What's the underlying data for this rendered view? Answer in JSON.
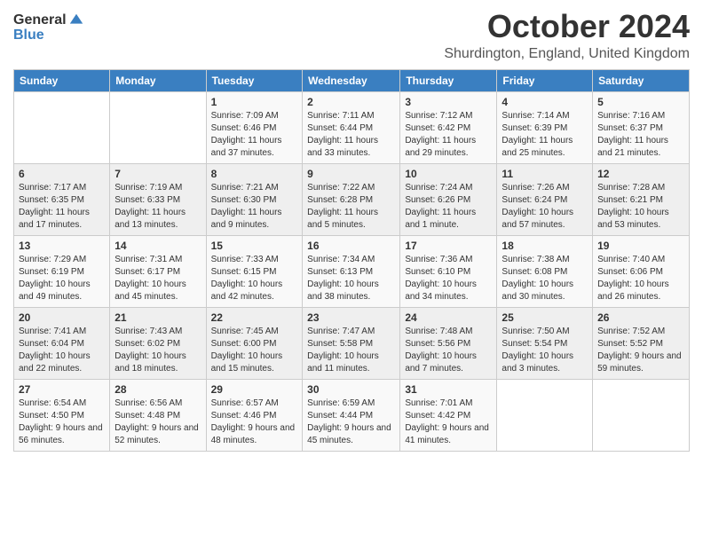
{
  "logo": {
    "general": "General",
    "blue": "Blue"
  },
  "header": {
    "month": "October 2024",
    "location": "Shurdington, England, United Kingdom"
  },
  "days_of_week": [
    "Sunday",
    "Monday",
    "Tuesday",
    "Wednesday",
    "Thursday",
    "Friday",
    "Saturday"
  ],
  "weeks": [
    [
      {
        "day": "",
        "info": ""
      },
      {
        "day": "",
        "info": ""
      },
      {
        "day": "1",
        "info": "Sunrise: 7:09 AM\nSunset: 6:46 PM\nDaylight: 11 hours and 37 minutes."
      },
      {
        "day": "2",
        "info": "Sunrise: 7:11 AM\nSunset: 6:44 PM\nDaylight: 11 hours and 33 minutes."
      },
      {
        "day": "3",
        "info": "Sunrise: 7:12 AM\nSunset: 6:42 PM\nDaylight: 11 hours and 29 minutes."
      },
      {
        "day": "4",
        "info": "Sunrise: 7:14 AM\nSunset: 6:39 PM\nDaylight: 11 hours and 25 minutes."
      },
      {
        "day": "5",
        "info": "Sunrise: 7:16 AM\nSunset: 6:37 PM\nDaylight: 11 hours and 21 minutes."
      }
    ],
    [
      {
        "day": "6",
        "info": "Sunrise: 7:17 AM\nSunset: 6:35 PM\nDaylight: 11 hours and 17 minutes."
      },
      {
        "day": "7",
        "info": "Sunrise: 7:19 AM\nSunset: 6:33 PM\nDaylight: 11 hours and 13 minutes."
      },
      {
        "day": "8",
        "info": "Sunrise: 7:21 AM\nSunset: 6:30 PM\nDaylight: 11 hours and 9 minutes."
      },
      {
        "day": "9",
        "info": "Sunrise: 7:22 AM\nSunset: 6:28 PM\nDaylight: 11 hours and 5 minutes."
      },
      {
        "day": "10",
        "info": "Sunrise: 7:24 AM\nSunset: 6:26 PM\nDaylight: 11 hours and 1 minute."
      },
      {
        "day": "11",
        "info": "Sunrise: 7:26 AM\nSunset: 6:24 PM\nDaylight: 10 hours and 57 minutes."
      },
      {
        "day": "12",
        "info": "Sunrise: 7:28 AM\nSunset: 6:21 PM\nDaylight: 10 hours and 53 minutes."
      }
    ],
    [
      {
        "day": "13",
        "info": "Sunrise: 7:29 AM\nSunset: 6:19 PM\nDaylight: 10 hours and 49 minutes."
      },
      {
        "day": "14",
        "info": "Sunrise: 7:31 AM\nSunset: 6:17 PM\nDaylight: 10 hours and 45 minutes."
      },
      {
        "day": "15",
        "info": "Sunrise: 7:33 AM\nSunset: 6:15 PM\nDaylight: 10 hours and 42 minutes."
      },
      {
        "day": "16",
        "info": "Sunrise: 7:34 AM\nSunset: 6:13 PM\nDaylight: 10 hours and 38 minutes."
      },
      {
        "day": "17",
        "info": "Sunrise: 7:36 AM\nSunset: 6:10 PM\nDaylight: 10 hours and 34 minutes."
      },
      {
        "day": "18",
        "info": "Sunrise: 7:38 AM\nSunset: 6:08 PM\nDaylight: 10 hours and 30 minutes."
      },
      {
        "day": "19",
        "info": "Sunrise: 7:40 AM\nSunset: 6:06 PM\nDaylight: 10 hours and 26 minutes."
      }
    ],
    [
      {
        "day": "20",
        "info": "Sunrise: 7:41 AM\nSunset: 6:04 PM\nDaylight: 10 hours and 22 minutes."
      },
      {
        "day": "21",
        "info": "Sunrise: 7:43 AM\nSunset: 6:02 PM\nDaylight: 10 hours and 18 minutes."
      },
      {
        "day": "22",
        "info": "Sunrise: 7:45 AM\nSunset: 6:00 PM\nDaylight: 10 hours and 15 minutes."
      },
      {
        "day": "23",
        "info": "Sunrise: 7:47 AM\nSunset: 5:58 PM\nDaylight: 10 hours and 11 minutes."
      },
      {
        "day": "24",
        "info": "Sunrise: 7:48 AM\nSunset: 5:56 PM\nDaylight: 10 hours and 7 minutes."
      },
      {
        "day": "25",
        "info": "Sunrise: 7:50 AM\nSunset: 5:54 PM\nDaylight: 10 hours and 3 minutes."
      },
      {
        "day": "26",
        "info": "Sunrise: 7:52 AM\nSunset: 5:52 PM\nDaylight: 9 hours and 59 minutes."
      }
    ],
    [
      {
        "day": "27",
        "info": "Sunrise: 6:54 AM\nSunset: 4:50 PM\nDaylight: 9 hours and 56 minutes."
      },
      {
        "day": "28",
        "info": "Sunrise: 6:56 AM\nSunset: 4:48 PM\nDaylight: 9 hours and 52 minutes."
      },
      {
        "day": "29",
        "info": "Sunrise: 6:57 AM\nSunset: 4:46 PM\nDaylight: 9 hours and 48 minutes."
      },
      {
        "day": "30",
        "info": "Sunrise: 6:59 AM\nSunset: 4:44 PM\nDaylight: 9 hours and 45 minutes."
      },
      {
        "day": "31",
        "info": "Sunrise: 7:01 AM\nSunset: 4:42 PM\nDaylight: 9 hours and 41 minutes."
      },
      {
        "day": "",
        "info": ""
      },
      {
        "day": "",
        "info": ""
      }
    ]
  ]
}
